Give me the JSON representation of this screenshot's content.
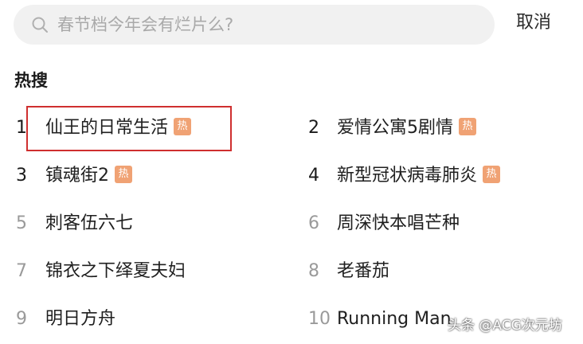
{
  "search": {
    "placeholder": "春节档今年会有烂片么?",
    "icon": "search-icon",
    "cancel_label": "取消"
  },
  "hot_search": {
    "title": "热搜",
    "hot_badge": "热",
    "badge_color": "#f0a274",
    "highlight_color": "#cf2f2f",
    "items": [
      {
        "rank": "1",
        "label": "仙王的日常生活",
        "hot": true
      },
      {
        "rank": "2",
        "label": "爱情公寓5剧情",
        "hot": true
      },
      {
        "rank": "3",
        "label": "镇魂街2",
        "hot": true
      },
      {
        "rank": "4",
        "label": "新型冠状病毒肺炎",
        "hot": true
      },
      {
        "rank": "5",
        "label": "刺客伍六七",
        "hot": false
      },
      {
        "rank": "6",
        "label": "周深快本唱芒种",
        "hot": false
      },
      {
        "rank": "7",
        "label": "锦衣之下绎夏夫妇",
        "hot": false
      },
      {
        "rank": "8",
        "label": "老番茄",
        "hot": false
      },
      {
        "rank": "9",
        "label": "明日方舟",
        "hot": false
      },
      {
        "rank": "10",
        "label": "Running Man",
        "hot": false
      }
    ]
  },
  "watermark": "头条 @ACG次元坊"
}
